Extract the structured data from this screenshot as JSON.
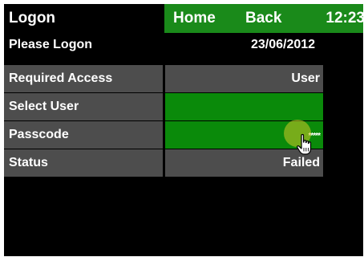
{
  "topbar": {
    "title": "Logon",
    "home_label": "Home",
    "back_label": "Back",
    "time": "12:23"
  },
  "header": {
    "prompt": "Please Logon",
    "date": "23/06/2012"
  },
  "rows": [
    {
      "label": "Required Access",
      "value": "User"
    },
    {
      "label": "Select User",
      "value": ""
    },
    {
      "label": "Passcode",
      "value": "*****"
    },
    {
      "label": "Status",
      "value": "Failed"
    }
  ],
  "colors": {
    "nav_green": "#1a8a1a",
    "field_green": "#0a8a0a",
    "row_grey": "#4d4d4d",
    "background": "#000000"
  },
  "icons": {
    "cursor": "hand-pointer-icon"
  }
}
